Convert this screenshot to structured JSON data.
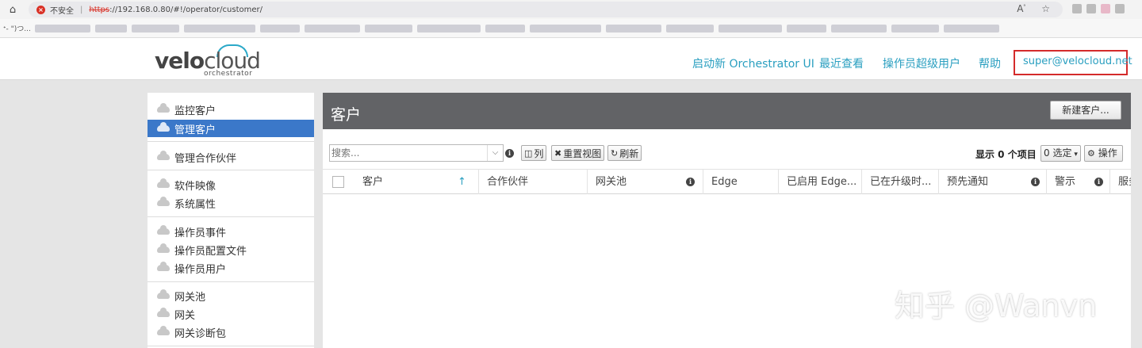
{
  "browser": {
    "security_label": "不安全",
    "url_protocol": "https",
    "url_rest": "://192.168.0.80/#!/operator/customer/",
    "bookmark_first": "ᐩ- \")つ..."
  },
  "header": {
    "logo_main": "velo",
    "logo_cloud": "cloud",
    "logo_sub": "orchestrator",
    "nav": {
      "launch": "启动新 Orchestrator UI",
      "recent": "最近查看",
      "superuser": "操作员超级用户",
      "help": "帮助",
      "user": "super@velocloud.net"
    }
  },
  "sidebar": {
    "items": [
      {
        "label": "监控客户"
      },
      {
        "label": "管理客户"
      },
      {
        "label": "管理合作伙伴"
      },
      {
        "label": "软件映像"
      },
      {
        "label": "系统属性"
      },
      {
        "label": "操作员事件"
      },
      {
        "label": "操作员配置文件"
      },
      {
        "label": "操作员用户"
      },
      {
        "label": "网关池"
      },
      {
        "label": "网关"
      },
      {
        "label": "网关诊断包"
      }
    ]
  },
  "main": {
    "title": "客户",
    "new_button": "新建客户...",
    "search_placeholder": "搜索...",
    "btn_columns": "列",
    "btn_reset_view": "重置视图",
    "btn_refresh": "刷新",
    "count_label": "显示 0 个项目",
    "select_label": "0 选定",
    "ops_label": "操作",
    "columns": [
      "客户",
      "合作伙伴",
      "网关池",
      "Edge",
      "已启用 Edge...",
      "已在升级时...",
      "预先通知",
      "警示",
      "服务"
    ]
  },
  "watermark": "知乎 @Wanvn"
}
